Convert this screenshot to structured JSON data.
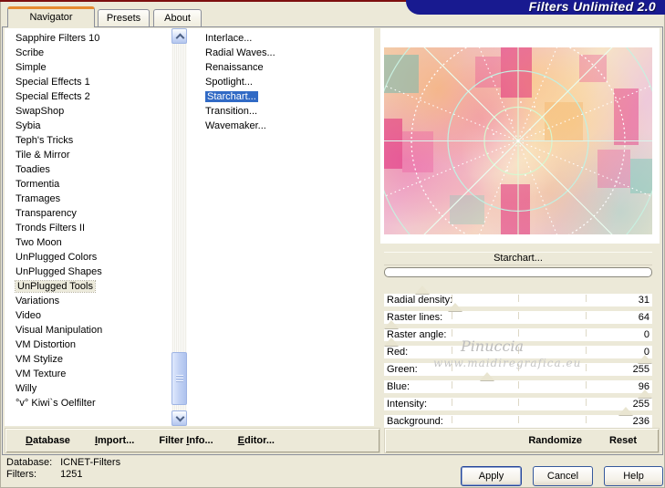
{
  "window": {
    "title": "Filters Unlimited 2.0"
  },
  "tabs": [
    {
      "label": "Navigator",
      "active": true
    },
    {
      "label": "Presets",
      "active": false
    },
    {
      "label": "About",
      "active": false
    }
  ],
  "category_list": {
    "items": [
      "Sapphire Filters 10",
      "Scribe",
      "Simple",
      "Special Effects 1",
      "Special Effects 2",
      "SwapShop",
      "Sybia",
      "Teph's Tricks",
      "Tile & Mirror",
      "Toadies",
      "Tormentia",
      "Tramages",
      "Transparency",
      "Tronds Filters II",
      "Two Moon",
      "UnPlugged Colors",
      "UnPlugged Shapes",
      "UnPlugged Tools",
      "Variations",
      "Video",
      "Visual Manipulation",
      "VM Distortion",
      "VM Stylize",
      "VM Texture",
      "Willy",
      "°v° Kiwi`s Oelfilter"
    ],
    "selected": "UnPlugged Tools"
  },
  "filter_list": {
    "items": [
      "Interlace...",
      "Radial Waves...",
      "Renaissance",
      "Spotlight...",
      "Starchart...",
      "Transition...",
      "Wavemaker..."
    ],
    "selected": "Starchart..."
  },
  "preview": {
    "caption": "Starchart..."
  },
  "sliders": [
    {
      "label": "Radial density:",
      "value": 31
    },
    {
      "label": "Raster lines:",
      "value": 64
    },
    {
      "label": "Raster angle:",
      "value": 0
    },
    {
      "label": "Red:",
      "value": 0
    },
    {
      "label": "Green:",
      "value": 255
    },
    {
      "label": "Blue:",
      "value": 96
    },
    {
      "label": "Intensity:",
      "value": 255
    },
    {
      "label": "Background:",
      "value": 236
    }
  ],
  "toolbar_left": [
    {
      "id": "database",
      "pre": "",
      "accel": "D",
      "rest": "atabase"
    },
    {
      "id": "import",
      "pre": "",
      "accel": "I",
      "rest": "mport..."
    },
    {
      "id": "filter-info",
      "pre": "Filter ",
      "accel": "I",
      "rest": "nfo..."
    },
    {
      "id": "editor",
      "pre": "",
      "accel": "E",
      "rest": "ditor..."
    }
  ],
  "toolbar_right": [
    {
      "id": "randomize",
      "pre": "Randomize",
      "accel": "",
      "rest": ""
    },
    {
      "id": "reset",
      "pre": "Reset",
      "accel": "",
      "rest": ""
    }
  ],
  "status": {
    "rows": [
      {
        "label": "Database:",
        "value": "ICNET-Filters"
      },
      {
        "label": "Filters:",
        "value": "1251"
      }
    ]
  },
  "buttons": [
    "Apply",
    "Cancel",
    "Help"
  ],
  "watermark": {
    "line1": "Pinuccia",
    "line2": "www.maidiregrafica.eu"
  },
  "colors": {
    "bg": "#ece9d8",
    "banner": "#181a90",
    "maroon": "#7d0f0f",
    "accent": "#e68b2f",
    "selection": "#316ac5"
  }
}
